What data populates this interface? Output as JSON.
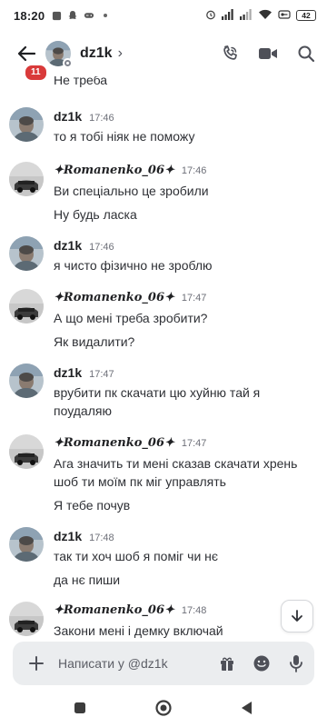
{
  "status_bar": {
    "time": "18:20",
    "battery": "42",
    "left_icons": [
      "notification-icon",
      "snapchat-icon",
      "gamepad-icon",
      "dot-icon"
    ],
    "right_icons": [
      "alarm-icon",
      "signal-icon",
      "signal-icon",
      "wifi-icon",
      "vpn-icon",
      "battery-icon"
    ]
  },
  "header": {
    "unread_badge": "11",
    "name": "dz1k",
    "chevron": "›",
    "actions": [
      "call-icon",
      "video-icon",
      "search-icon"
    ]
  },
  "messages": {
    "cut_line": "Не треба",
    "groups": [
      {
        "author": "dz1k",
        "time": "17:46",
        "lines": [
          "то я тобі ніяк не поможу"
        ]
      },
      {
        "author": "✦𝑹𝒐𝒎𝒂𝒏𝒆𝒏𝒌𝒐_06✦",
        "time": "17:46",
        "lines": [
          "Ви спеціально це зробили",
          "Ну будь ласка"
        ]
      },
      {
        "author": "dz1k",
        "time": "17:46",
        "lines": [
          "я чисто фізично не зроблю"
        ]
      },
      {
        "author": "✦𝑹𝒐𝒎𝒂𝒏𝒆𝒏𝒌𝒐_06✦",
        "time": "17:47",
        "lines": [
          "А що мені треба зробити?",
          "Як видалити?"
        ]
      },
      {
        "author": "dz1k",
        "time": "17:47",
        "lines": [
          "врубити пк скачати цю хуйню тай я",
          "поудаляю"
        ]
      },
      {
        "author": "✦𝑹𝒐𝒎𝒂𝒏𝒆𝒏𝒌𝒐_06✦",
        "time": "17:47",
        "lines": [
          "Ага значить ти мені сказав скачати хрень",
          "шоб ти моїм пк міг управлять",
          "Я тебе почув"
        ]
      },
      {
        "author": "dz1k",
        "time": "17:48",
        "lines": [
          "так ти хоч шоб я поміг чи нє",
          "да нє пиши"
        ]
      },
      {
        "author": "✦𝑹𝒐𝒎𝒂𝒏𝒆𝒏𝒌𝒐_06✦",
        "time": "17:48",
        "lines": [
          "Закони мені і демку включай"
        ]
      }
    ]
  },
  "composer": {
    "placeholder": "Написати у @dz1k",
    "tools": [
      "gift-icon",
      "emoji-icon",
      "microphone-icon"
    ]
  },
  "jump_button_icon": "arrow-down-icon",
  "nav_bar": [
    "recent-apps-icon",
    "home-icon",
    "back-icon"
  ]
}
